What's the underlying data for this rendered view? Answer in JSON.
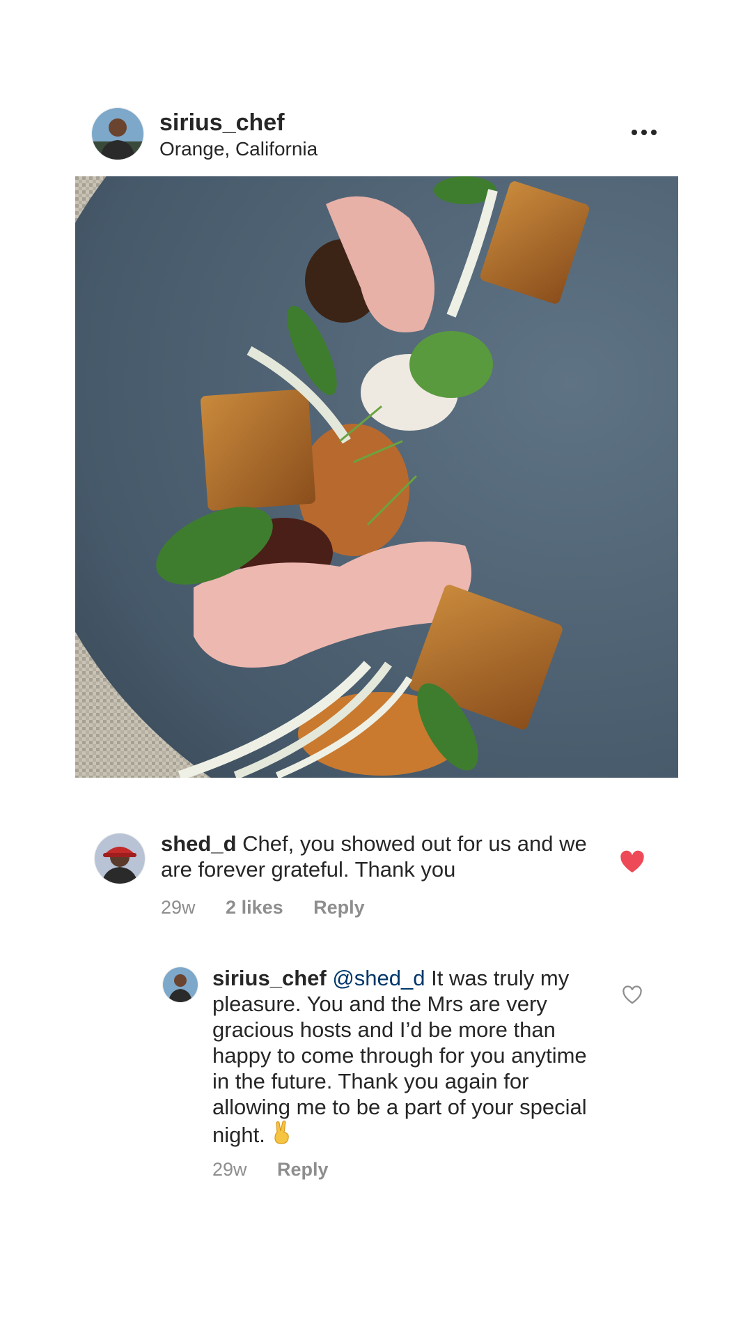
{
  "post": {
    "username": "sirius_chef",
    "location": "Orange, California",
    "more_icon": "more-options-icon",
    "photo_alt": "plated dish"
  },
  "comments": [
    {
      "username": "shed_d",
      "text": "Chef, you showed out for us and we are forever grateful. Thank you",
      "time": "29w",
      "likes": "2 likes",
      "reply": "Reply",
      "liked": true,
      "heart_color": "#ed4956"
    },
    {
      "username": "sirius_chef",
      "mention": "@shed_d",
      "text": "It was truly my pleasure. You and the Mrs are very gracious hosts and I’d be more than happy to come through for you anytime in the future. Thank you again for allowing me to be a part of your special night.",
      "emoji": "✌",
      "time": "29w",
      "reply": "Reply",
      "liked": false
    }
  ],
  "colors": {
    "text": "#262626",
    "meta": "#8e8e8e",
    "mention": "#00376b",
    "like": "#ed4956"
  }
}
